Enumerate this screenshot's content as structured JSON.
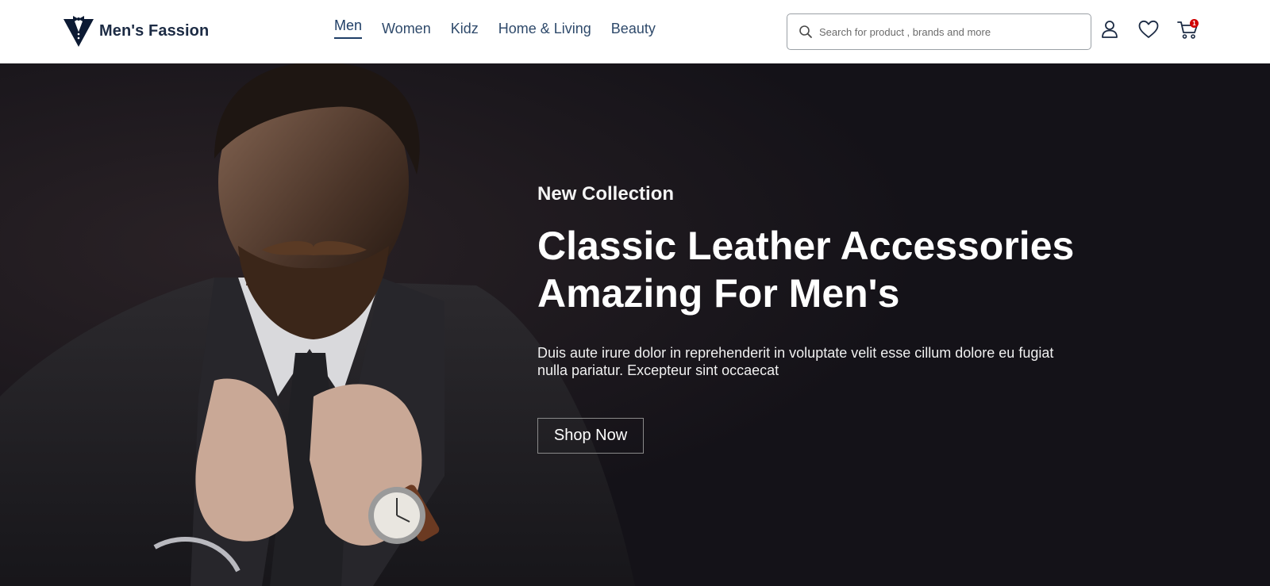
{
  "brand": {
    "name": "Men's Fassion",
    "logo": "tuxedo-logo-icon",
    "color": "#1c2b44"
  },
  "nav": {
    "items": [
      {
        "label": "Men",
        "active": true
      },
      {
        "label": "Women",
        "active": false
      },
      {
        "label": "Kidz",
        "active": false
      },
      {
        "label": "Home & Living",
        "active": false
      },
      {
        "label": "Beauty",
        "active": false
      }
    ]
  },
  "search": {
    "placeholder": "Search for product , brands and more",
    "value": "",
    "icon": "search-icon"
  },
  "header_icons": {
    "profile": "user-icon",
    "wishlist": "heart-icon",
    "cart": {
      "icon": "cart-icon",
      "badge_count": "1",
      "badge_color": "#d00000"
    }
  },
  "hero": {
    "image": "man-in-suit-with-watch",
    "eyebrow": "New Collection",
    "title_line1": "Classic Leather Accessories",
    "title_line2": "Amazing For Men's",
    "description": "Duis aute irure dolor in reprehenderit in voluptate velit esse cillum dolore eu fugiat nulla pariatur. Excepteur sint occaecat",
    "cta_label": "Shop Now",
    "background_color": "#141218"
  }
}
